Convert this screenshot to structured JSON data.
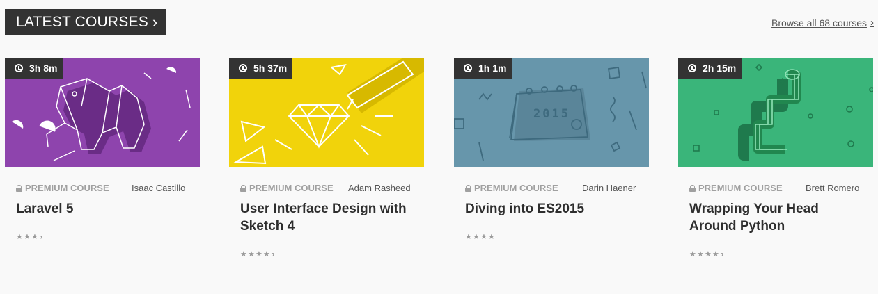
{
  "header": {
    "title": "LATEST COURSES",
    "chevron": "›"
  },
  "browse": {
    "label": "Browse all 68 courses",
    "chevron": "›"
  },
  "courses": [
    {
      "duration": "3h 8m",
      "badge": "PREMIUM COURSE",
      "author": "Isaac Castillo",
      "title": "Laravel 5",
      "rating": 3.5,
      "thumb_color": "#8e44ad"
    },
    {
      "duration": "5h 37m",
      "badge": "PREMIUM COURSE",
      "author": "Adam Rasheed",
      "title": "User Interface Design with Sketch 4",
      "rating": 4.5,
      "thumb_color": "#f1d30b"
    },
    {
      "duration": "1h 1m",
      "badge": "PREMIUM COURSE",
      "author": "Darin Haener",
      "title": "Diving into ES2015",
      "rating": 4,
      "thumb_color": "#6796ab"
    },
    {
      "duration": "2h 15m",
      "badge": "PREMIUM COURSE",
      "author": "Brett Romero",
      "title": "Wrapping Your Head Around Python",
      "rating": 4.5,
      "thumb_color": "#3ab57a"
    }
  ],
  "thumb_art": {
    "2": {
      "year": "2015"
    }
  },
  "icons": {
    "clock": "clock-icon",
    "lock": "lock-icon",
    "star": "star-icon"
  }
}
